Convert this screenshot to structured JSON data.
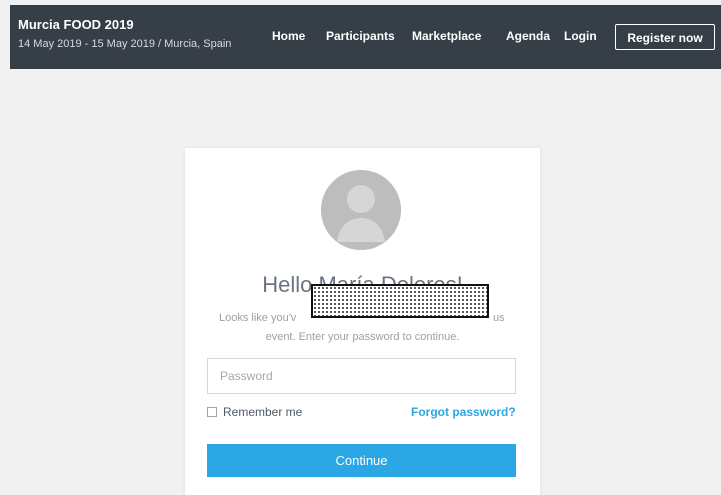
{
  "header": {
    "title": "Murcia FOOD 2019",
    "meta": "14 May 2019 - 15 May 2019 / Murcia, Spain",
    "nav": {
      "home": "Home",
      "participants": "Participants",
      "marketplace": "Marketplace",
      "agenda": "Agenda",
      "login": "Login"
    },
    "register": "Register now",
    "background": "#363e48"
  },
  "login_card": {
    "greeting": "Hello María Dolores!",
    "description_start": "Looks like you'v",
    "description_end": "us",
    "description_line2": "event. Enter your password to continue.",
    "password_placeholder": "Password",
    "remember_me": "Remember me",
    "forgot_password": "Forgot password?",
    "continue": "Continue",
    "accent": "#2aa7e4"
  },
  "icons": {
    "avatar": "user-avatar-placeholder"
  }
}
